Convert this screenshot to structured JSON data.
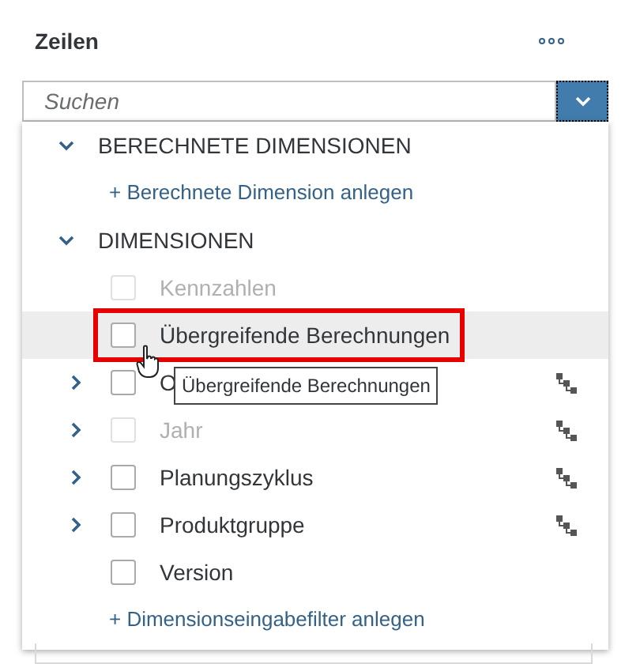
{
  "panel": {
    "title": "Zeilen"
  },
  "search": {
    "placeholder": "Suchen",
    "dropdown_open": true
  },
  "sections": [
    {
      "title": "BERECHNETE DIMENSIONEN",
      "expanded": true,
      "link": "+ Berechnete Dimension anlegen"
    },
    {
      "title": "DIMENSIONEN",
      "expanded": true,
      "items": [
        {
          "label": "Kennzahlen",
          "disabled": true,
          "checked": false,
          "expandable": false,
          "hierarchy": false,
          "highlighted": false
        },
        {
          "label": "Übergreifende Berechnungen",
          "disabled": false,
          "checked": false,
          "expandable": false,
          "hierarchy": false,
          "highlighted": true
        },
        {
          "label": "O",
          "disabled": false,
          "checked": false,
          "expandable": true,
          "hierarchy": true,
          "highlighted": false
        },
        {
          "label": "Jahr",
          "disabled": true,
          "checked": false,
          "expandable": true,
          "hierarchy": true,
          "highlighted": false
        },
        {
          "label": "Planungszyklus",
          "disabled": false,
          "checked": false,
          "expandable": true,
          "hierarchy": true,
          "highlighted": false
        },
        {
          "label": "Produktgruppe",
          "disabled": false,
          "checked": false,
          "expandable": true,
          "hierarchy": true,
          "highlighted": false
        },
        {
          "label": "Version",
          "disabled": false,
          "checked": false,
          "expandable": false,
          "hierarchy": false,
          "highlighted": false
        }
      ],
      "link": "+ Dimensionseingabefilter anlegen"
    }
  ],
  "tooltip": {
    "text": "Übergreifende Berechnungen"
  }
}
